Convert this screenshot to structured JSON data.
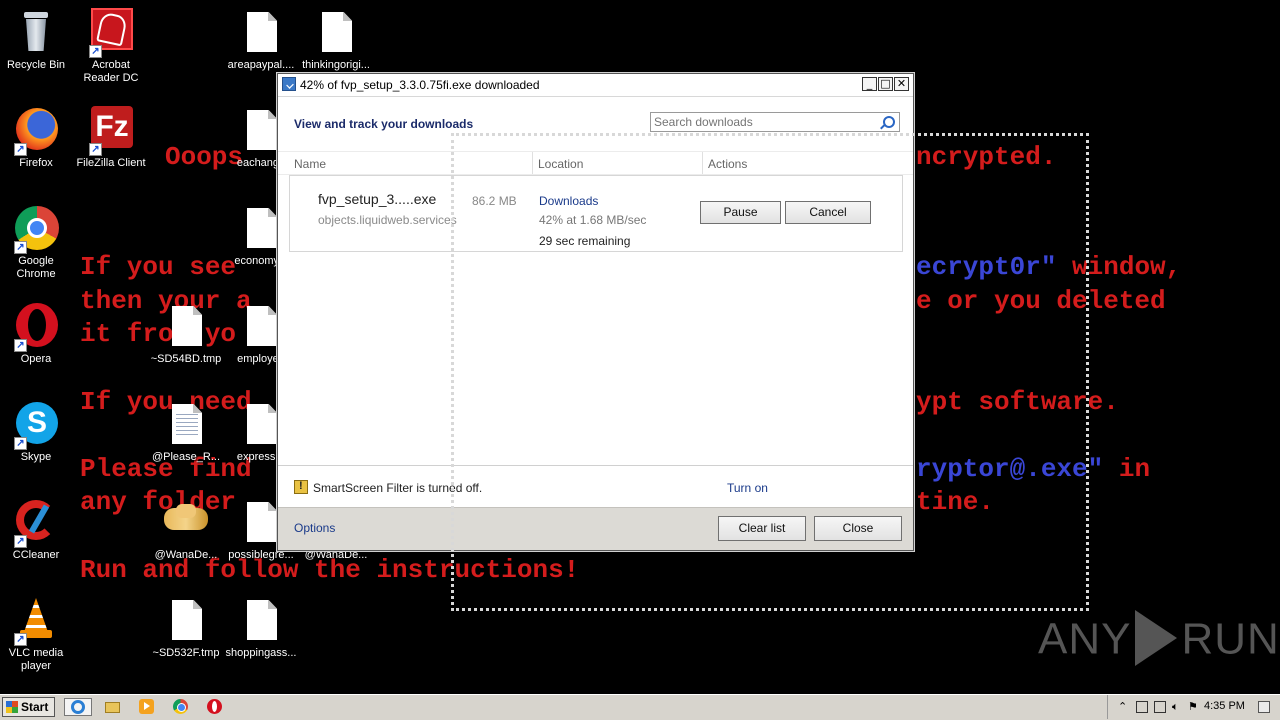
{
  "wallpaper": {
    "line1a": "Ooops",
    "line1b": "ncrypted.",
    "line2a": "If you see",
    "line2b_blue": "ecrypt0r\"",
    "line2c": "window,",
    "line3a": "then your a",
    "line3b": "e or you deleted",
    "line4": "it from yo",
    "line5a": "If you need",
    "line5b": "ypt software.",
    "line6a": "Please find",
    "line6b_blue": "ryptor@.exe\"",
    "line6c": "in",
    "line7a": "any folder",
    "line7b": "tine.",
    "line8": "Run and follow the instructions!"
  },
  "desktop_icons": [
    {
      "label": "Recycle Bin",
      "icon": "recycle-bin-icon"
    },
    {
      "label": "Acrobat Reader DC",
      "icon": "acrobat-icon"
    },
    {
      "label": "areapaypal....",
      "icon": "file-icon"
    },
    {
      "label": "thinkingorigi...",
      "icon": "file-icon"
    },
    {
      "label": "Firefox",
      "icon": "firefox-icon"
    },
    {
      "label": "FileZilla Client",
      "icon": "filezilla-icon"
    },
    {
      "label": "eachange",
      "icon": "file-icon"
    },
    {
      "label": "Google Chrome",
      "icon": "chrome-icon"
    },
    {
      "label": "economyld",
      "icon": "file-icon"
    },
    {
      "label": "Opera",
      "icon": "opera-icon"
    },
    {
      "label": "~SD54BD.tmp",
      "icon": "file-icon"
    },
    {
      "label": "employee",
      "icon": "file-icon"
    },
    {
      "label": "Skype",
      "icon": "skype-icon"
    },
    {
      "label": "@Please_R...",
      "icon": "text-file-icon"
    },
    {
      "label": "expressre",
      "icon": "file-icon"
    },
    {
      "label": "CCleaner",
      "icon": "ccleaner-icon"
    },
    {
      "label": "@WanaDe...",
      "icon": "handshake-icon"
    },
    {
      "label": "possiblegre...",
      "icon": "file-icon"
    },
    {
      "label": "@WanaDe...",
      "icon": "file-icon"
    },
    {
      "label": "VLC media player",
      "icon": "vlc-icon"
    },
    {
      "label": "~SD532F.tmp",
      "icon": "file-icon"
    },
    {
      "label": "shoppingass...",
      "icon": "file-icon"
    }
  ],
  "dialog": {
    "title": "42% of fvp_setup_3.3.0.75fi.exe downloaded",
    "header": "View and track your downloads",
    "search_placeholder": "Search downloads",
    "columns": {
      "name": "Name",
      "location": "Location",
      "actions": "Actions"
    },
    "download": {
      "file_name": "fvp_setup_3.....exe",
      "size": "86.2 MB",
      "host": "objects.liquidweb.services",
      "location": "Downloads",
      "progress": "42% at 1.68 MB/sec",
      "progress_fraction": 0.42,
      "remaining": "29 sec remaining",
      "pause_label": "Pause",
      "cancel_label": "Cancel"
    },
    "smartscreen_text": "SmartScreen Filter is turned off.",
    "turn_on_label": "Turn on",
    "options_label": "Options",
    "clear_list_label": "Clear list",
    "close_label": "Close",
    "window_buttons": {
      "minimize": "_",
      "maximize": "□",
      "close": "✕"
    }
  },
  "watermark": {
    "left": "ANY",
    "right": "RUN"
  },
  "taskbar": {
    "start_label": "Start",
    "clock": "4:35 PM"
  }
}
